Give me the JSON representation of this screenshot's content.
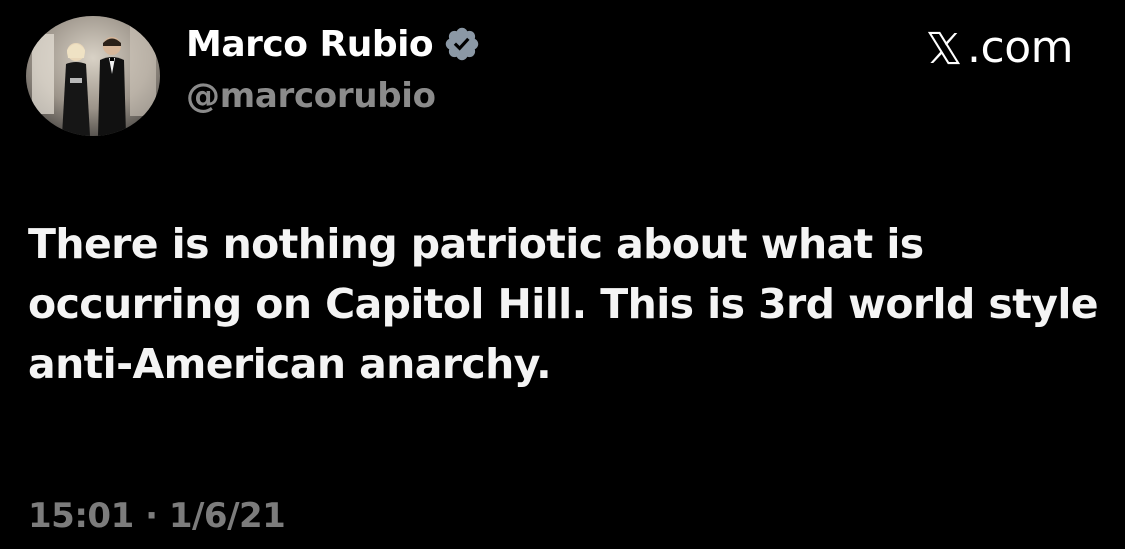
{
  "author": {
    "display_name": "Marco Rubio",
    "handle": "@marcorubio",
    "verified_icon": "verified-badge-icon",
    "verified_color": "#8b98a5"
  },
  "brand": {
    "logo_icon": "x-logo-icon",
    "text": ".com"
  },
  "tweet": {
    "text": "There is nothing patriotic about what is occurring on Capitol Hill. This is 3rd world style anti-American anarchy.",
    "time": "15:01",
    "separator": "·",
    "date": "1/6/21"
  },
  "colors": {
    "background": "#000000",
    "text_primary": "#ffffff",
    "text_secondary": "#7c7c7c"
  }
}
